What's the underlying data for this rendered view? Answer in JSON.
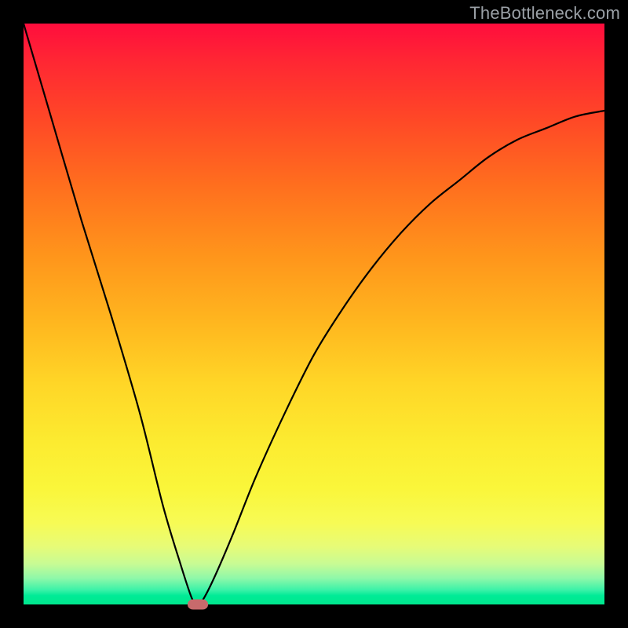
{
  "attribution": "TheBottleneck.com",
  "chart_data": {
    "type": "line",
    "title": "",
    "xlabel": "",
    "ylabel": "",
    "xlim": [
      0,
      100
    ],
    "ylim": [
      0,
      100
    ],
    "background_gradient": {
      "orientation": "vertical",
      "stops": [
        {
          "pct": 0,
          "color": "#ff0d3d"
        },
        {
          "pct": 40,
          "color": "#ff951b"
        },
        {
          "pct": 72,
          "color": "#fceb30"
        },
        {
          "pct": 95,
          "color": "#8ef8a9"
        },
        {
          "pct": 100,
          "color": "#00e88e"
        }
      ]
    },
    "series": [
      {
        "name": "bottleneck-curve",
        "x": [
          0,
          5,
          10,
          15,
          20,
          24,
          27,
          29,
          30,
          31,
          33,
          36,
          40,
          45,
          50,
          55,
          60,
          65,
          70,
          75,
          80,
          85,
          90,
          95,
          100
        ],
        "y": [
          100,
          83,
          66,
          50,
          33,
          17,
          7,
          1,
          0,
          1,
          5,
          12,
          22,
          33,
          43,
          51,
          58,
          64,
          69,
          73,
          77,
          80,
          82,
          84,
          85
        ]
      }
    ],
    "marker": {
      "x": 30,
      "y": 0,
      "color": "#c86a6c"
    }
  }
}
